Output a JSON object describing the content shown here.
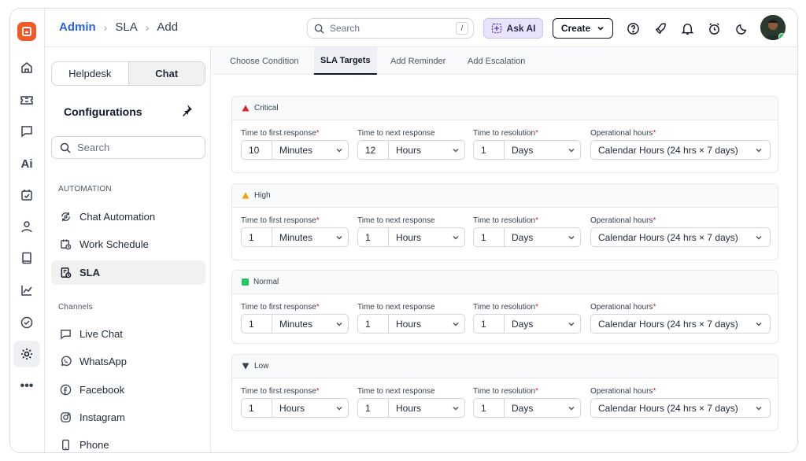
{
  "breadcrumb": {
    "root": "Admin",
    "level1": "SLA",
    "level2": "Add"
  },
  "topbar": {
    "search_placeholder": "Search",
    "search_shortcut": "/",
    "ask_ai_label": "Ask AI",
    "create_label": "Create"
  },
  "sidebar": {
    "segments": [
      "Helpdesk",
      "Chat"
    ],
    "active_segment": "Chat",
    "heading": "Configurations",
    "search_placeholder": "Search",
    "automation_label": "AUTOMATION",
    "automation_items": [
      {
        "label": "Chat Automation",
        "icon": "automation-icon"
      },
      {
        "label": "Work Schedule",
        "icon": "calendar-clock-icon"
      },
      {
        "label": "SLA",
        "icon": "sla-clock-icon",
        "active": true
      }
    ],
    "channels_label": "Channels",
    "channel_items": [
      {
        "label": "Live Chat",
        "icon": "chat-bubble-icon"
      },
      {
        "label": "WhatsApp",
        "icon": "whatsapp-icon"
      },
      {
        "label": "Facebook",
        "icon": "facebook-icon"
      },
      {
        "label": "Instagram",
        "icon": "instagram-icon"
      },
      {
        "label": "Phone",
        "icon": "phone-icon"
      }
    ]
  },
  "tabs": [
    "Choose Condition",
    "SLA Targets",
    "Add Reminder",
    "Add Escalation"
  ],
  "active_tab": "SLA Targets",
  "labels": {
    "first": "Time to first response",
    "next": "Time to next response",
    "resolution": "Time to resolution",
    "ops": "Operational hours",
    "required_mark": "*"
  },
  "priorities": [
    {
      "name": "Critical",
      "color": "#dc2626",
      "icon": "triangle-up-icon",
      "first": {
        "value": "10",
        "unit": "Minutes",
        "required": true
      },
      "next": {
        "value": "12",
        "unit": "Hours",
        "required": false
      },
      "resolution": {
        "value": "1",
        "unit": "Days",
        "required": true
      },
      "ops": "Calendar Hours (24 hrs × 7 days)"
    },
    {
      "name": "High",
      "color": "#f59e0b",
      "icon": "triangle-up-icon",
      "first": {
        "value": "1",
        "unit": "Minutes",
        "required": true
      },
      "next": {
        "value": "1",
        "unit": "Hours",
        "required": false
      },
      "resolution": {
        "value": "1",
        "unit": "Days",
        "required": true
      },
      "ops": "Calendar Hours (24 hrs × 7 days)"
    },
    {
      "name": "Normal",
      "color": "#22c55e",
      "icon": "square-icon",
      "first": {
        "value": "1",
        "unit": "Minutes",
        "required": true
      },
      "next": {
        "value": "1",
        "unit": "Hours",
        "required": false
      },
      "resolution": {
        "value": "1",
        "unit": "Days",
        "required": true
      },
      "ops": "Calendar Hours (24 hrs × 7 days)"
    },
    {
      "name": "Low",
      "color": "#374151",
      "icon": "triangle-down-icon",
      "first": {
        "value": "1",
        "unit": "Hours",
        "required": true
      },
      "next": {
        "value": "1",
        "unit": "Hours",
        "required": false
      },
      "resolution": {
        "value": "1",
        "unit": "Days",
        "required": true
      },
      "ops": "Calendar Hours (24 hrs × 7 days)"
    }
  ]
}
